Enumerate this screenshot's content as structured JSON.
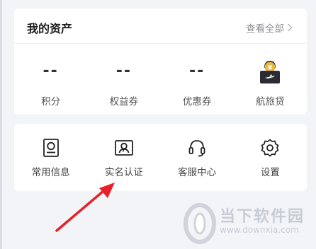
{
  "assets": {
    "title": "我的资产",
    "view_all": "查看全部",
    "items": [
      {
        "value": "--",
        "label": "积分"
      },
      {
        "value": "--",
        "label": "权益券"
      },
      {
        "value": "--",
        "label": "优惠券"
      },
      {
        "label": "航旅贷"
      }
    ]
  },
  "menu": {
    "items": [
      {
        "label": "常用信息",
        "icon": "profile-card-icon"
      },
      {
        "label": "实名认证",
        "icon": "id-card-icon"
      },
      {
        "label": "客服中心",
        "icon": "headset-icon"
      },
      {
        "label": "设置",
        "icon": "gear-icon"
      }
    ]
  },
  "watermark": {
    "brand": "当下软件园",
    "url": "www.downxia.com"
  },
  "colors": {
    "page_bg": "#f3f4f8",
    "card_bg": "#ffffff",
    "arrow": "#e8202a",
    "loan_icon_gold": "#e9b83f",
    "loan_icon_dark": "#2b2b33"
  }
}
